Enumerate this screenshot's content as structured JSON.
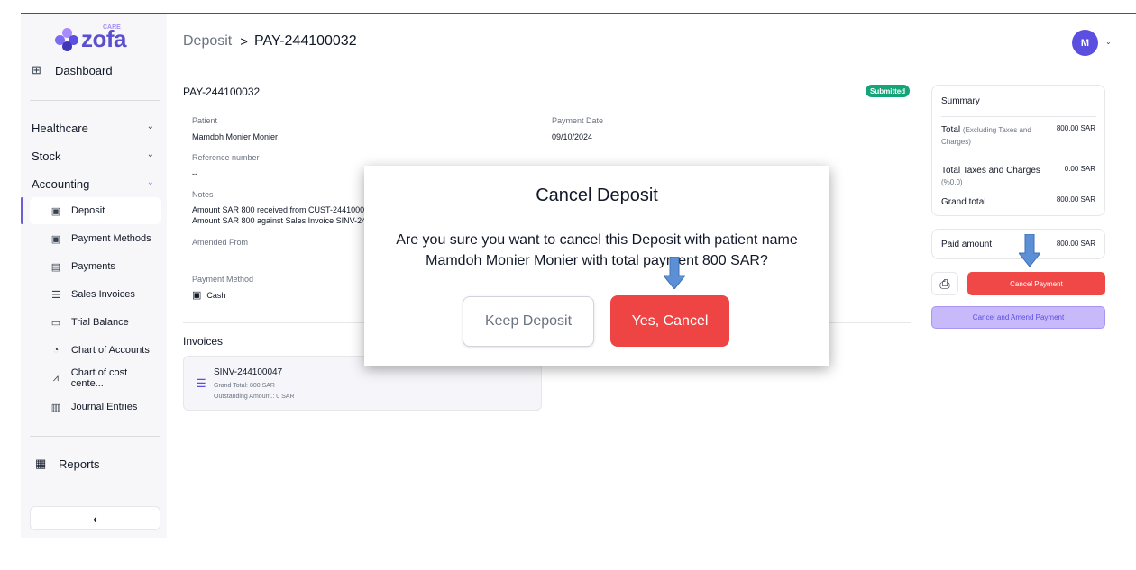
{
  "logo": {
    "text": "zofa",
    "care": "CARE"
  },
  "sidebar": {
    "dashboard": "Dashboard",
    "groups": [
      {
        "label": "Healthcare"
      },
      {
        "label": "Stock"
      },
      {
        "label": "Accounting"
      }
    ],
    "items": [
      {
        "label": "Deposit"
      },
      {
        "label": "Payment Methods"
      },
      {
        "label": "Payments"
      },
      {
        "label": "Sales Invoices"
      },
      {
        "label": "Trial Balance"
      },
      {
        "label": "Chart of Accounts"
      },
      {
        "label": "Chart of cost cente..."
      },
      {
        "label": "Journal Entries"
      }
    ],
    "reports": "Reports",
    "collapse": "‹"
  },
  "header": {
    "crumb_root": "Deposit",
    "crumb_sep": ">",
    "crumb_current": "PAY-244100032",
    "avatar": "M"
  },
  "main": {
    "doc_id": "PAY-244100032",
    "status": "Submitted",
    "patient_label": "Patient",
    "patient_value": "Mamdoh Monier Monier",
    "payment_date_label": "Payment Date",
    "payment_date_value": "09/10/2024",
    "reference_label": "Reference number",
    "reference_value": "--",
    "notes_label": "Notes",
    "notes_line1": "Amount SAR 800 received from CUST-2441000",
    "notes_line2": "Amount SAR 800 against Sales Invoice SINV-24",
    "amended_label": "Amended From",
    "method_label": "Payment Method",
    "method_value": "Cash",
    "invoices_title": "Invoices",
    "invoice": {
      "id": "SINV-244100047",
      "grand_total": "Grand Total: 800 SAR",
      "outstanding": "Outstanding Amount.: 0 SAR"
    }
  },
  "summary": {
    "title": "Summary",
    "total_label": "Total",
    "total_note": "(Excluding Taxes and Charges)",
    "total_value": "800.00 SAR",
    "taxes_label": "Total Taxes and Charges",
    "taxes_note": "(%0.0)",
    "taxes_value": "0.00 SAR",
    "grand_label": "Grand total",
    "grand_value": "800.00 SAR",
    "paid_label": "Paid amount",
    "paid_value": "800.00 SAR",
    "cancel_payment": "Cancel Payment",
    "cancel_amend": "Cancel and Amend Payment"
  },
  "modal": {
    "title": "Cancel Deposit",
    "message": "Are you sure you want to cancel this Deposit with patient name Mamdoh Monier Monier with total payment 800 SAR?",
    "keep": "Keep Deposit",
    "confirm": "Yes, Cancel"
  },
  "colors": {
    "brand": "#5b4fe0",
    "danger": "#ef4444",
    "success": "#14a47a",
    "annotation_arrow": "#5b8fd6"
  }
}
